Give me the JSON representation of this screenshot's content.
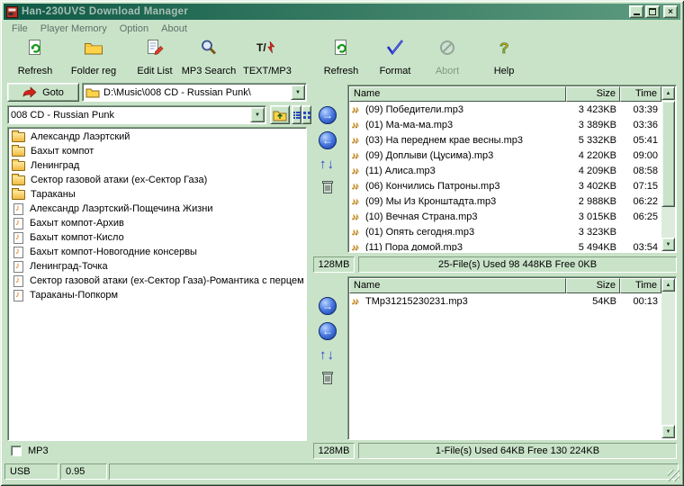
{
  "window": {
    "title": "Han-230UVS Download Manager"
  },
  "colors": {
    "face": "#c9e3c9",
    "titlebar_start": "#0e5946",
    "titlebar_end": "#5f9c80",
    "accent_blue": "#2a3ed8"
  },
  "menu": {
    "items": [
      {
        "label": "File"
      },
      {
        "label": "Player Memory"
      },
      {
        "label": "Option"
      },
      {
        "label": "About"
      }
    ]
  },
  "toolbar": {
    "left": [
      {
        "label": "Refresh"
      },
      {
        "label": "Folder reg"
      },
      {
        "label": "Edit List"
      },
      {
        "label": "MP3 Search"
      },
      {
        "label": "TEXT/MP3"
      }
    ],
    "right": [
      {
        "label": "Refresh"
      },
      {
        "label": "Format"
      },
      {
        "label": "Abort",
        "disabled": true
      },
      {
        "label": "Help"
      }
    ]
  },
  "explorer": {
    "goto_label": "Goto",
    "path": "D:\\Music\\008 CD - Russian Punk\\",
    "folder_combo": "008 CD - Russian Punk",
    "items": [
      {
        "icon": "folder",
        "label": "Александр Лаэртский"
      },
      {
        "icon": "folder",
        "label": "Бахыт компот"
      },
      {
        "icon": "folder",
        "label": "Ленинград"
      },
      {
        "icon": "folder",
        "label": "Сектор газовой атаки (ex-Сектор Газа)"
      },
      {
        "icon": "folder",
        "label": "Тараканы"
      },
      {
        "icon": "playlist",
        "label": "Александр Лаэртский-Пощечина Жизни"
      },
      {
        "icon": "playlist",
        "label": "Бахыт компот-Архив"
      },
      {
        "icon": "playlist",
        "label": "Бахыт компот-Кисло"
      },
      {
        "icon": "playlist",
        "label": "Бахыт компот-Новогодние консервы"
      },
      {
        "icon": "playlist",
        "label": "Ленинград-Точка"
      },
      {
        "icon": "playlist",
        "label": "Сектор газовой атаки (ex-Сектор Газа)-Романтика с перцем"
      },
      {
        "icon": "playlist",
        "label": "Тараканы-Попкорм"
      }
    ],
    "mp3_checkbox": {
      "label": "MP3",
      "checked": false
    }
  },
  "device_top": {
    "columns": {
      "name": "Name",
      "size": "Size",
      "time": "Time"
    },
    "rows": [
      {
        "name": "(09) Победители.mp3",
        "size": "3 423KB",
        "time": "03:39"
      },
      {
        "name": "(01) Ма-ма-ма.mp3",
        "size": "3 389KB",
        "time": "03:36"
      },
      {
        "name": "(03) На переднем крае весны.mp3",
        "size": "5 332KB",
        "time": "05:41"
      },
      {
        "name": "(09) Доплыви (Цусима).mp3",
        "size": "4 220KB",
        "time": "09:00"
      },
      {
        "name": "(11) Алиса.mp3",
        "size": "4 209KB",
        "time": "08:58"
      },
      {
        "name": "(06) Кончились Патроны.mp3",
        "size": "3 402KB",
        "time": "07:15"
      },
      {
        "name": "(09) Мы Из Кронштадта.mp3",
        "size": "2 988KB",
        "time": "06:22"
      },
      {
        "name": "(10) Вечная Страна.mp3",
        "size": "3 015KB",
        "time": "06:25"
      },
      {
        "name": "(01) Опять сегодня.mp3",
        "size": "3 323KB",
        "time": ""
      },
      {
        "name": "(11) Пора домой.mp3",
        "size": "5 494KB",
        "time": "03:54"
      }
    ],
    "memory": "128MB",
    "status": "25-File(s)  Used 98 448KB  Free 0KB"
  },
  "device_bottom": {
    "columns": {
      "name": "Name",
      "size": "Size",
      "time": "Time"
    },
    "rows": [
      {
        "name": "TMp31215230231.mp3",
        "size": "54KB",
        "time": "00:13"
      }
    ],
    "memory": "128MB",
    "status": "1-File(s)  Used 64KB  Free 130 224KB"
  },
  "statusbar": {
    "device": "USB",
    "version": "0.95"
  }
}
